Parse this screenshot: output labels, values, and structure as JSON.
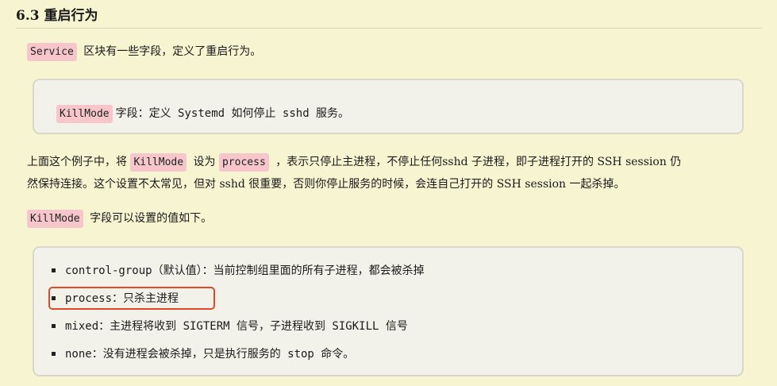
{
  "section": {
    "heading": "6.3 重启行为"
  },
  "intro": {
    "code": "Service",
    "text": "区块有一些字段，定义了重启行为。"
  },
  "box1": {
    "code": "KillMode",
    "text": "字段：定义 Systemd 如何停止 sshd 服务。"
  },
  "para2": {
    "before": "上面这个例子中，将",
    "code1": "KillMode",
    "middle": "设为",
    "code2": "process",
    "after": "，表示只停止主进程，不停止任何sshd 子进程，即子进程打开的 SSH session 仍",
    "line2": "然保持连接。这个设置不太常见，但对 sshd 很重要，否则你停止服务的时候，会连自己打开的 SSH session 一起杀掉。"
  },
  "para3": {
    "code": "KillMode",
    "text": "字段可以设置的值如下。"
  },
  "list": [
    "control-group（默认值）：当前控制组里面的所有子进程，都会被杀掉",
    "process：只杀主进程",
    "mixed：主进程将收到 SIGTERM 信号，子进程收到 SIGKILL 信号",
    "none：没有进程会被杀掉，只是执行服务的 stop 命令。"
  ],
  "colors": {
    "background": "#f6f4d1",
    "code_bg": "#f6c6cb",
    "highlight": "#e04a2a"
  }
}
